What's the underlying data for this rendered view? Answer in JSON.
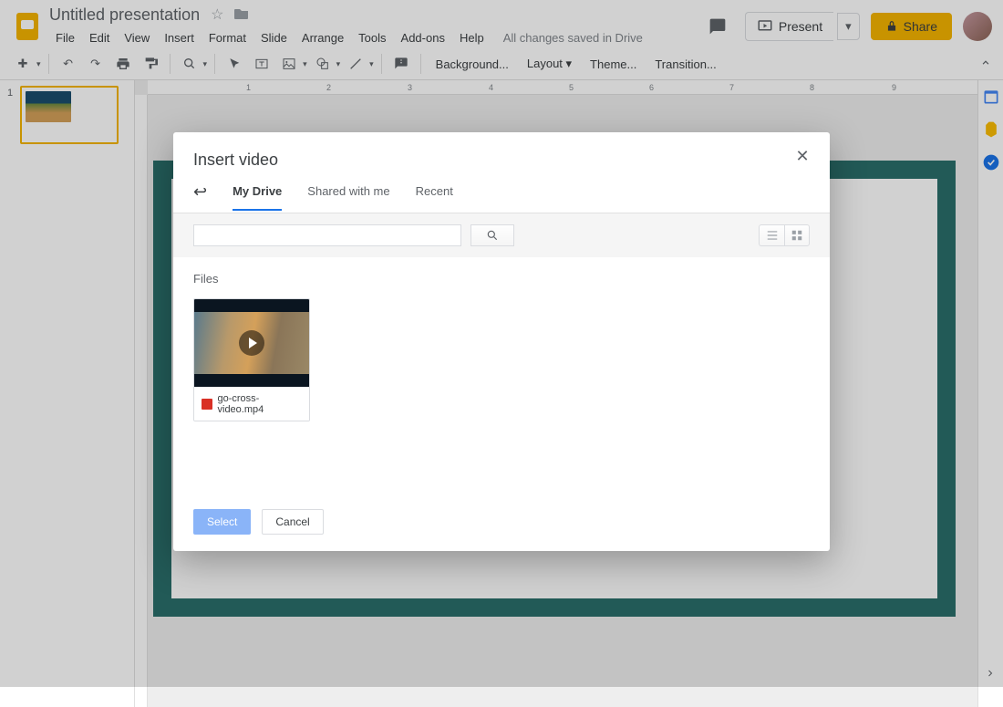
{
  "header": {
    "doc_title": "Untitled presentation",
    "drive_status": "All changes saved in Drive",
    "menu": [
      "File",
      "Edit",
      "View",
      "Insert",
      "Format",
      "Slide",
      "Arrange",
      "Tools",
      "Add-ons",
      "Help"
    ],
    "present_label": "Present",
    "share_label": "Share"
  },
  "toolbar": {
    "items": [
      "Background...",
      "Layout ▾",
      "Theme...",
      "Transition..."
    ]
  },
  "ruler": {
    "marks": [
      "1",
      "2",
      "3",
      "4",
      "5",
      "6",
      "7",
      "8",
      "9"
    ]
  },
  "thumbnails": [
    {
      "number": "1"
    }
  ],
  "dialog": {
    "title": "Insert video",
    "tabs": [
      "My Drive",
      "Shared with me",
      "Recent"
    ],
    "active_tab": 0,
    "files_label": "Files",
    "files": [
      {
        "name": "go-cross-video.mp4"
      }
    ],
    "select_label": "Select",
    "cancel_label": "Cancel",
    "search_placeholder": ""
  }
}
